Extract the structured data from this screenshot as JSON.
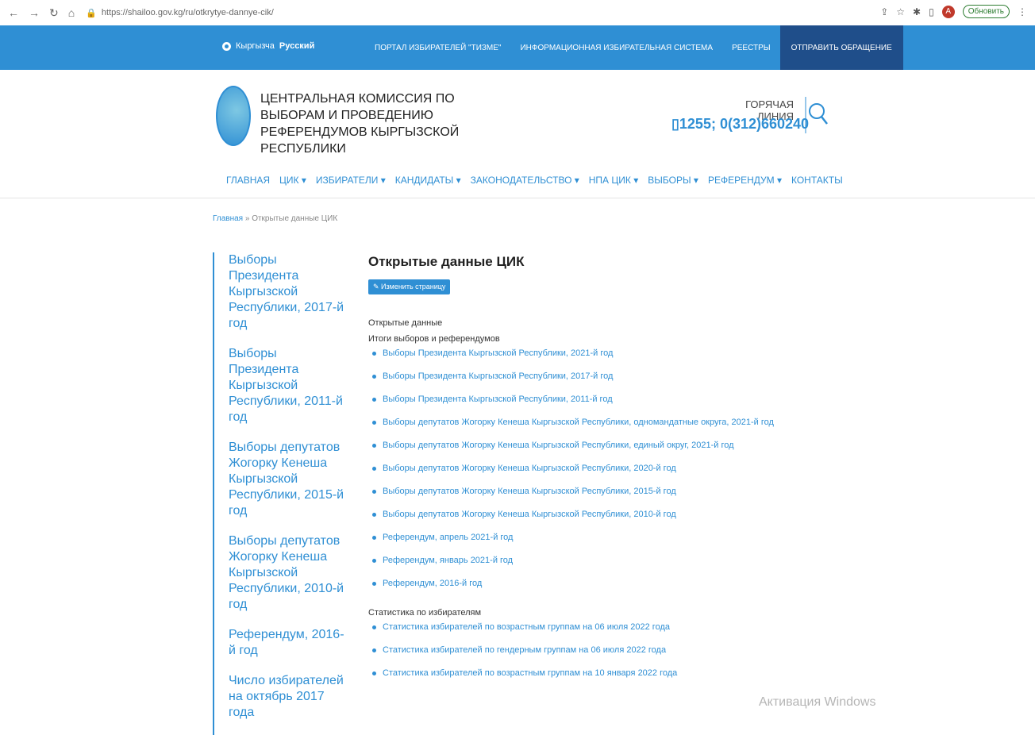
{
  "browser": {
    "url": "https://shailoo.gov.kg/ru/otkrytye-dannye-cik/",
    "update_label": "Обновить",
    "avatar_letter": "A"
  },
  "topbar": {
    "lang_kg": "Кыргызча",
    "lang_ru": "Русский",
    "link_portal": "ПОРТАЛ ИЗБИРАТЕЛЕЙ \"ТИЗМЕ\"",
    "link_info": "ИНФОРМАЦИОННАЯ ИЗБИРАТЕЛЬНАЯ СИСТЕМА",
    "link_registers": "РЕЕСТРЫ",
    "link_send": "ОТПРАВИТЬ ОБРАЩЕНИЕ"
  },
  "header": {
    "org_name": "ЦЕНТРАЛЬНАЯ КОМИССИЯ ПО ВЫБОРАМ И ПРОВЕДЕНИЮ РЕФЕРЕНДУМОВ КЫРГЫЗСКОЙ РЕСПУБЛИКИ",
    "hotline_label": "ГОРЯЧАЯ ЛИНИЯ",
    "hotline_phone": "1255; 0(312)660240"
  },
  "mainnav": [
    "ГЛАВНАЯ",
    "ЦИК ▾",
    "ИЗБИРАТЕЛИ ▾",
    "КАНДИДАТЫ ▾",
    "ЗАКОНОДАТЕЛЬСТВО ▾",
    "НПА ЦИК ▾",
    "ВЫБОРЫ ▾",
    "РЕФЕРЕНДУМ ▾",
    "КОНТАКТЫ"
  ],
  "breadcrumb": {
    "home": "Главная",
    "sep": " » ",
    "current": "Открытые данные ЦИК"
  },
  "sidebar": [
    "Выборы Президента Кыргызской Республики, 2017-й год",
    "Выборы Президента Кыргызской Республики, 2011-й год",
    "Выборы депутатов Жогорку Кенеша Кыргызской Республики, 2015-й год",
    "Выборы депутатов Жогорку Кенеша Кыргызской Республики, 2010-й год",
    "Референдум, 2016-й год",
    "Число избирателей на октябрь 2017 года"
  ],
  "content": {
    "title": "Открытые данные ЦИК",
    "edit_button": "Изменить страницу",
    "section_open": "Открытые данные",
    "section_results": "Итоги выборов и референдумов",
    "results_links": [
      "Выборы Президента Кыргызской Республики, 2021-й год",
      "Выборы Президента Кыргызской Республики, 2017-й год",
      "Выборы Президента Кыргызской Республики, 2011-й год",
      "Выборы депутатов Жогорку Кенеша Кыргызской Республики, одномандатные округа, 2021-й год",
      "Выборы депутатов Жогорку Кенеша Кыргызской Республики, единый округ, 2021-й год",
      "Выборы депутатов Жогорку Кенеша Кыргызской Республики, 2020-й год",
      "Выборы депутатов Жогорку Кенеша Кыргызской Республики, 2015-й год",
      "Выборы депутатов Жогорку Кенеша Кыргызской Республики, 2010-й год",
      "Референдум, апрель 2021-й год",
      "Референдум, январь 2021-й год",
      "Референдум, 2016-й год"
    ],
    "section_stats": "Статистика по избирателям",
    "stats_links": [
      "Статистика избирателей по возрастным группам на 06 июля 2022 года",
      "Статистика избирателей по гендерным группам на 06 июля 2022 года",
      "Статистика избирателей по возрастным группам на 10 января 2022 года"
    ]
  },
  "watermark": "Активация Windows"
}
